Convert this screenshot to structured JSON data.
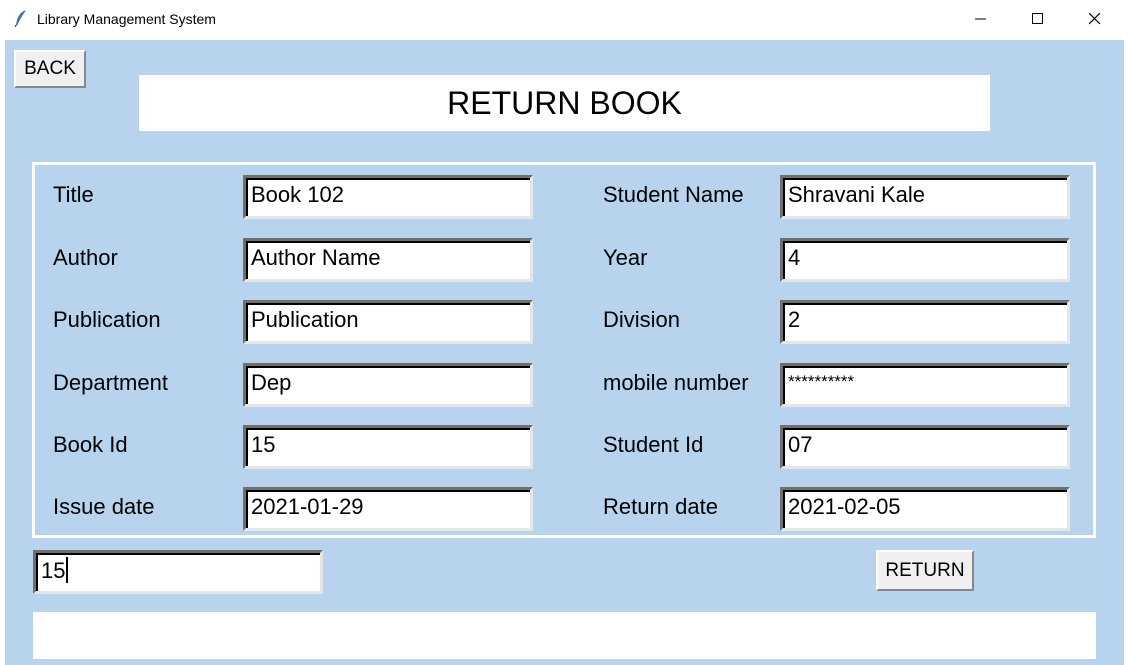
{
  "window": {
    "title": "Library Management System",
    "icon": "feather-icon",
    "controls": [
      "minimize-icon",
      "maximize-icon",
      "close-icon"
    ]
  },
  "page": {
    "back_label": "BACK",
    "heading": "RETURN BOOK",
    "return_label": "RETURN",
    "search_value": "15",
    "status_message": ""
  },
  "form": {
    "left": [
      {
        "label": "Title",
        "value": "Book 102"
      },
      {
        "label": "Author",
        "value": "Author Name"
      },
      {
        "label": "Publication",
        "value": "Publication"
      },
      {
        "label": "Department",
        "value": "Dep"
      },
      {
        "label": "Book Id",
        "value": "15"
      },
      {
        "label": "Issue date",
        "value": "2021-01-29"
      }
    ],
    "right": [
      {
        "label": "Student Name",
        "value": "Shravani Kale"
      },
      {
        "label": "Year",
        "value": "4"
      },
      {
        "label": "Division",
        "value": "2"
      },
      {
        "label": "mobile number",
        "value": "**********"
      },
      {
        "label": "Student Id",
        "value": "07"
      },
      {
        "label": "Return date",
        "value": "2021-02-05"
      }
    ]
  },
  "colors": {
    "background": "#b8d3ee",
    "panel": "#ffffff"
  }
}
